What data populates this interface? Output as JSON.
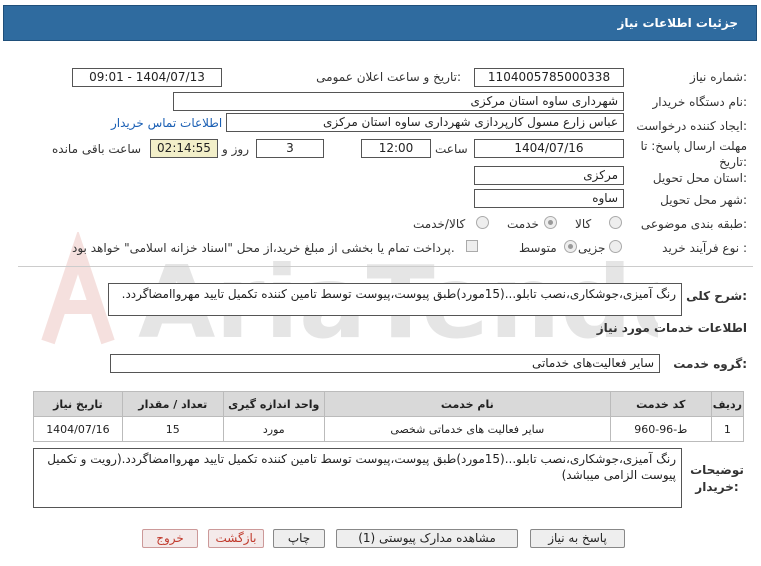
{
  "header": {
    "title": "جزئیات اطلاعات نیاز"
  },
  "form": {
    "need_number_label": "شماره نیاز:",
    "need_number": "1104005785000338",
    "announce_label": "تاریخ و ساعت اعلان عمومی:",
    "announce_value": "1404/07/13 - 09:01",
    "buyer_org_label": "نام دستگاه خریدار:",
    "buyer_org": "شهرداری ساوه استان مرکزی",
    "creator_label": "ایجاد کننده درخواست:",
    "creator": "عباس زارع مسول کارپردازی شهرداری ساوه استان مرکزی",
    "contact_link": "اطلاعات تماس خریدار",
    "deadline_label": "مهلت ارسال پاسخ: تا تاریخ:",
    "deadline_date": "1404/07/16",
    "time_label": "ساعت",
    "deadline_time": "12:00",
    "days": "3",
    "days_label": "روز و",
    "remaining_time": "02:14:55",
    "remaining_label": "ساعت باقی مانده",
    "province_label": "استان محل تحویل:",
    "province": "مرکزی",
    "city_label": "شهر محل تحویل:",
    "city": "ساوه",
    "category_label": "طبقه بندی موضوعی:",
    "category_options": [
      "کالا",
      "خدمت",
      "کالا/خدمت"
    ],
    "category_selected": "خدمت",
    "process_label": "نوع فرآیند خرید :",
    "process_options": [
      "جزیی",
      "متوسط"
    ],
    "process_selected": "متوسط",
    "payment_note": "پرداخت تمام یا بخشی از مبلغ خرید،از محل \"اسناد خزانه اسلامی\" خواهد بود."
  },
  "summary": {
    "label": "شرح کلی نیاز:",
    "text": "رنگ آمیزی،جوشکاری،نصب تابلو...(15مورد)طبق پیوست،پیوست توسط تامین کننده تکمیل تایید مهرواامضاگردد."
  },
  "services": {
    "section_title": "اطلاعات خدمات مورد نیاز",
    "group_label": "گروه خدمت:",
    "group_value": "سایر فعالیت‌های خدماتی",
    "columns": [
      "ردیف",
      "کد خدمت",
      "نام خدمت",
      "واحد اندازه گیری",
      "تعداد / مقدار",
      "تاریخ نیاز"
    ],
    "rows": [
      [
        "1",
        "ط-96-960",
        "سایر فعالیت های خدماتی شخصی",
        "مورد",
        "15",
        "1404/07/16"
      ]
    ]
  },
  "buyer_notes": {
    "label": "توضیحات خریدار:",
    "text": "رنگ آمیزی،جوشکاری،نصب تابلو...(15مورد)طبق پیوست،پیوست توسط تامین کننده تکمیل تایید مهرواامضاگردد.(رویت و تکمیل پیوست الزامی میباشد)"
  },
  "buttons": {
    "reply": "پاسخ به نیاز",
    "attachments": "مشاهده مدارک پیوستی (1)",
    "print": "چاپ",
    "back": "بازگشت",
    "exit": "خروج"
  }
}
